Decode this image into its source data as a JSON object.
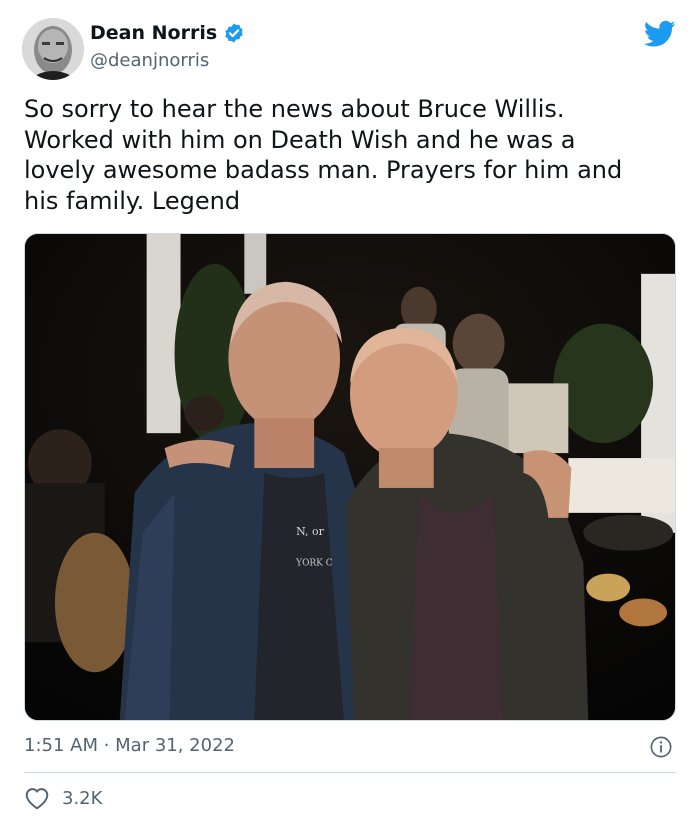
{
  "author": {
    "display_name": "Dean Norris",
    "handle": "@deanjnorris",
    "verified": true
  },
  "tweet": {
    "text": "So sorry to hear the news about Bruce Willis.\nWorked with him on Death Wish and he was a\nlovely awesome badass man. Prayers for him and\nhis family. Legend",
    "timestamp": "1:51 AM · Mar 31, 2022",
    "like_count": "3.2K"
  },
  "photo": {
    "shirt_print_line1": "N, or",
    "shirt_print_line2": "YORK C"
  },
  "icons": {
    "bird": "twitter-bird-icon",
    "verified": "verified-badge-icon",
    "info": "info-icon",
    "heart": "heart-icon"
  },
  "colors": {
    "twitter_blue": "#1d9bf0",
    "text_primary": "#0f1419",
    "text_secondary": "#536471",
    "border": "#cfd9de"
  }
}
